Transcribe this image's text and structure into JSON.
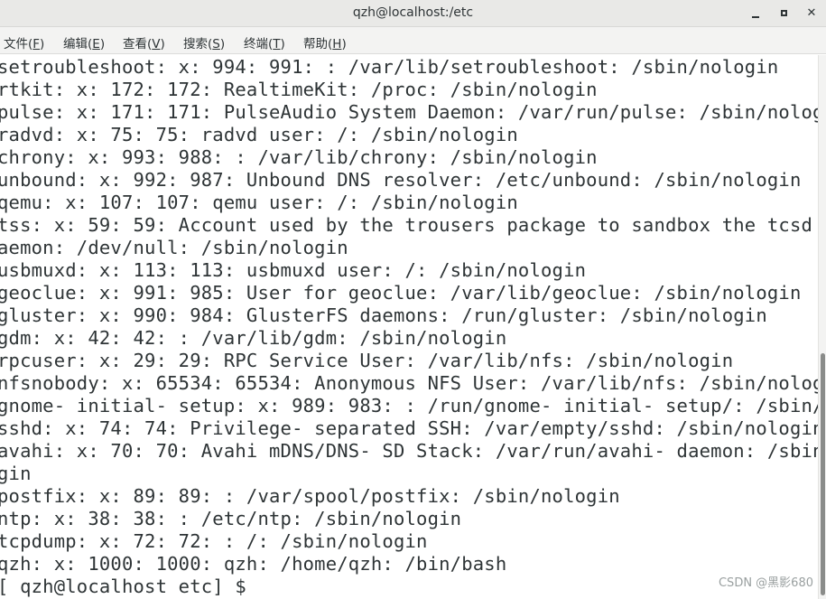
{
  "window": {
    "title": "qzh@localhost:/etc",
    "minimize_icon": "minimize-icon",
    "maximize_icon": "maximize-icon",
    "close_icon": "close-icon",
    "close_glyph": "✕"
  },
  "menu": {
    "items": [
      {
        "text": "文件(",
        "mnemonic": "F",
        "tail": ")"
      },
      {
        "text": "编辑(",
        "mnemonic": "E",
        "tail": ")"
      },
      {
        "text": "查看(",
        "mnemonic": "V",
        "tail": ")"
      },
      {
        "text": "搜索(",
        "mnemonic": "S",
        "tail": ")"
      },
      {
        "text": "终端(",
        "mnemonic": "T",
        "tail": ")"
      },
      {
        "text": "帮助(",
        "mnemonic": "H",
        "tail": ")"
      }
    ]
  },
  "terminal": {
    "lines": [
      "setroubleshoot: x: 994: 991: : /var/lib/setroubleshoot: /sbin/nologin",
      "rtkit: x: 172: 172: RealtimeKit: /proc: /sbin/nologin",
      "pulse: x: 171: 171: PulseAudio System Daemon: /var/run/pulse: /sbin/nologin",
      "radvd: x: 75: 75: radvd user: /: /sbin/nologin",
      "chrony: x: 993: 988: : /var/lib/chrony: /sbin/nologin",
      "unbound: x: 992: 987: Unbound DNS resolver: /etc/unbound: /sbin/nologin",
      "qemu: x: 107: 107: qemu user: /: /sbin/nologin",
      "tss: x: 59: 59: Account used by the trousers package to sandbox the tcsd d",
      "aemon: /dev/null: /sbin/nologin",
      "usbmuxd: x: 113: 113: usbmuxd user: /: /sbin/nologin",
      "geoclue: x: 991: 985: User for geoclue: /var/lib/geoclue: /sbin/nologin",
      "gluster: x: 990: 984: GlusterFS daemons: /run/gluster: /sbin/nologin",
      "gdm: x: 42: 42: : /var/lib/gdm: /sbin/nologin",
      "rpcuser: x: 29: 29: RPC Service User: /var/lib/nfs: /sbin/nologin",
      "nfsnobody: x: 65534: 65534: Anonymous NFS User: /var/lib/nfs: /sbin/nologin",
      "gnome- initial- setup: x: 989: 983: : /run/gnome- initial- setup/: /sbin/nologin",
      "sshd: x: 74: 74: Privilege- separated SSH: /var/empty/sshd: /sbin/nologin",
      "avahi: x: 70: 70: Avahi mDNS/DNS- SD Stack: /var/run/avahi- daemon: /sbin/nolo",
      "gin",
      "postfix: x: 89: 89: : /var/spool/postfix: /sbin/nologin",
      "ntp: x: 38: 38: : /etc/ntp: /sbin/nologin",
      "tcpdump: x: 72: 72: : /: /sbin/nologin",
      "qzh: x: 1000: 1000: qzh: /home/qzh: /bin/bash",
      "[ qzh@localhost etc] $"
    ]
  },
  "watermark": "CSDN @黑影680"
}
